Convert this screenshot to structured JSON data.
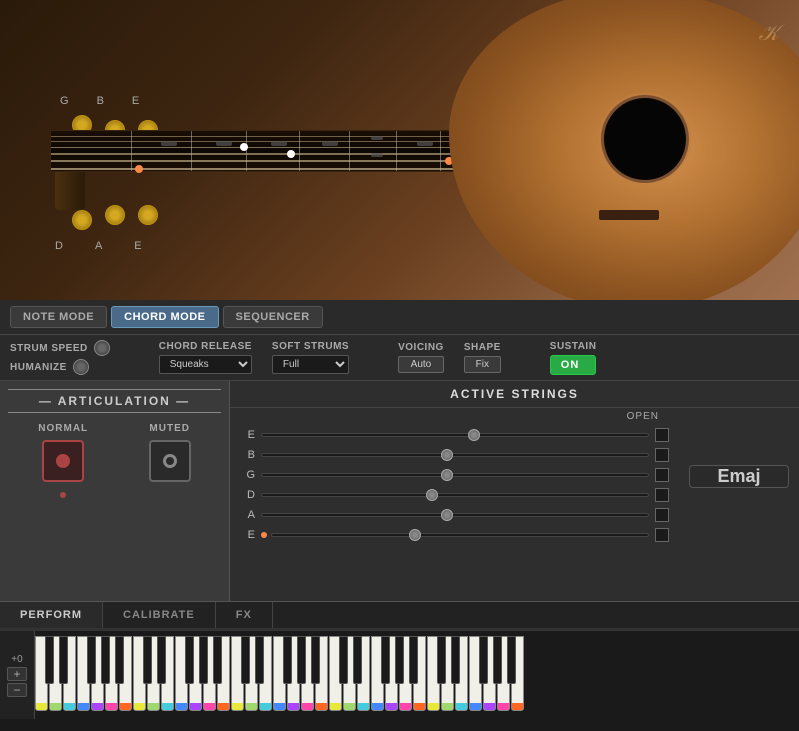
{
  "guitar": {
    "string_labels_top": [
      "G",
      "B",
      "E"
    ],
    "string_labels_bottom": [
      "D",
      "A",
      "E"
    ]
  },
  "mode_bar": {
    "note_mode_label": "NOTE MODE",
    "chord_mode_label": "CHORD MODE",
    "sequencer_label": "SEQUENCER",
    "active": "chord_mode"
  },
  "controls": {
    "strum_speed_label": "STRUM SPEED",
    "humanize_label": "HUMANIZE",
    "chord_release_label": "CHORD RELEASE",
    "chord_release_value": "Squeaks",
    "soft_strums_label": "SOFT STRUMS",
    "soft_strums_value": "Full",
    "voicing_label": "VOICING",
    "voicing_value": "Auto",
    "shape_label": "SHAPE",
    "shape_value": "Fix",
    "sustain_label": "SUSTAIN",
    "sustain_value": "ON"
  },
  "active_strings": {
    "title": "ACTIVE STRINGS",
    "open_label": "OPEN",
    "strings": [
      {
        "label": "E",
        "position": 55,
        "open": false
      },
      {
        "label": "B",
        "position": 48,
        "open": false
      },
      {
        "label": "G",
        "position": 48,
        "open": false
      },
      {
        "label": "D",
        "position": 44,
        "open": false
      },
      {
        "label": "A",
        "position": 48,
        "open": false
      },
      {
        "label": "E",
        "position": 38,
        "open": false,
        "dot": true
      }
    ]
  },
  "articulation": {
    "title": "ARTICULATION",
    "normal_label": "NORMAL",
    "muted_label": "MUTED",
    "active": "normal"
  },
  "chord": {
    "display": "Emaj"
  },
  "bottom_tabs": [
    {
      "label": "PERFORM",
      "active": true
    },
    {
      "label": "CALIBRATE",
      "active": false
    },
    {
      "label": "FX",
      "active": false
    }
  ],
  "piano": {
    "octave_label": "+0"
  }
}
